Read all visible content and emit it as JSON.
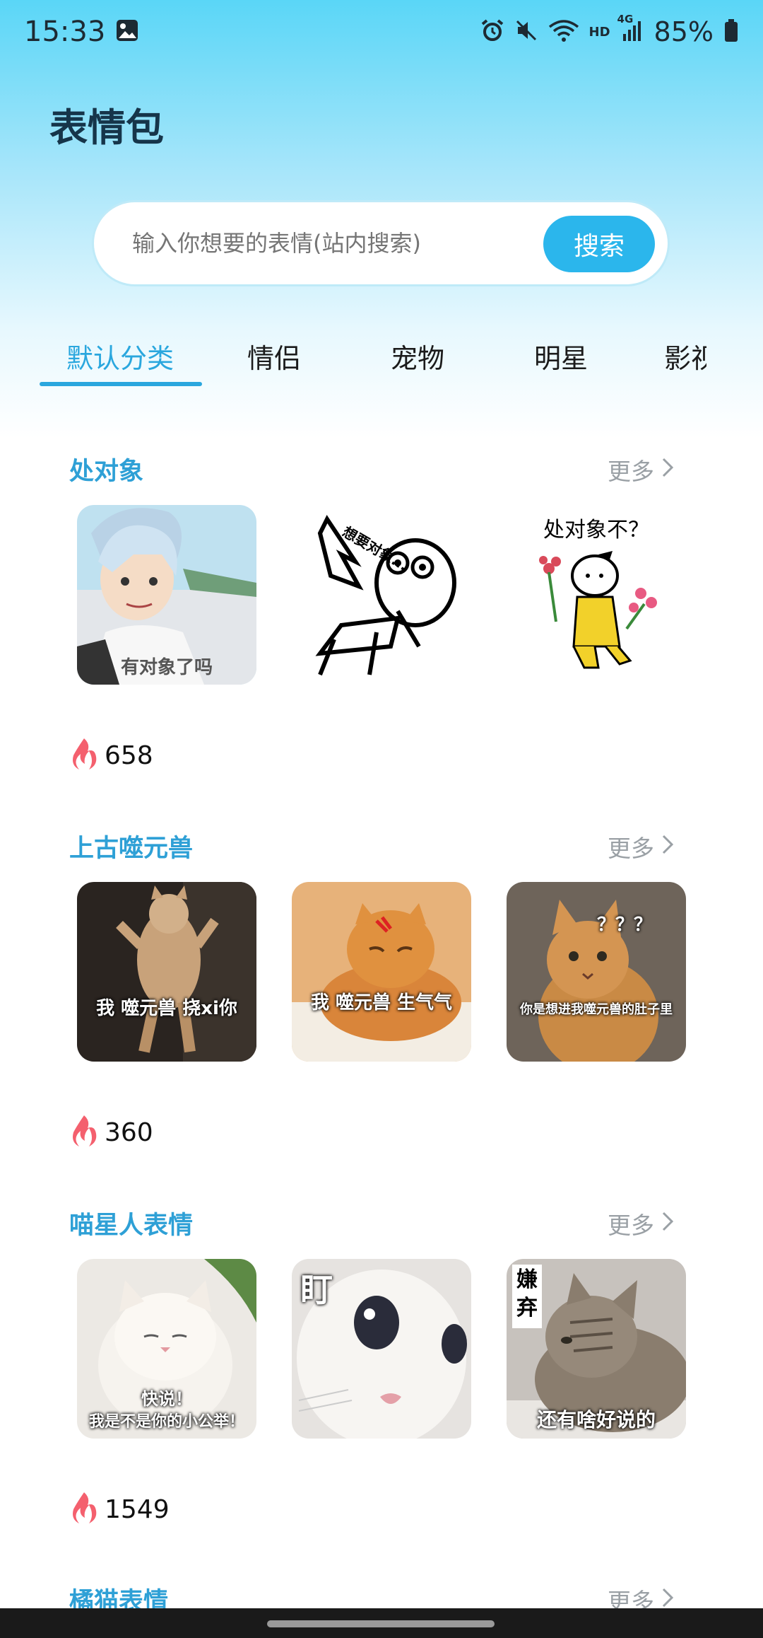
{
  "status": {
    "time": "15:33",
    "battery": "85%",
    "net": "4G",
    "hd": "HD"
  },
  "app": {
    "title": "表情包"
  },
  "search": {
    "placeholder": "输入你想要的表情(站内搜索)",
    "button": "搜索"
  },
  "tabs": [
    {
      "label": "默认分类",
      "active": true
    },
    {
      "label": "情侣"
    },
    {
      "label": "宠物"
    },
    {
      "label": "明星"
    },
    {
      "label": "影视"
    }
  ],
  "sections": [
    {
      "title": "处对象",
      "more": "更多",
      "count": "658",
      "thumbs": [
        {
          "caption": "有对象了吗"
        },
        {
          "caption": "想要对象..."
        },
        {
          "caption": "处对象不？"
        }
      ]
    },
    {
      "title": "上古噬元兽",
      "more": "更多",
      "count": "360",
      "thumbs": [
        {
          "caption": "我 噬元兽 挠xi你"
        },
        {
          "caption": "我 噬元兽 生气气"
        },
        {
          "caption": "你是想进我噬元兽的肚子里",
          "marks": "？？？"
        }
      ]
    },
    {
      "title": "喵星人表情",
      "more": "更多",
      "count": "1549",
      "thumbs": [
        {
          "caption1": "快说！",
          "caption2": "我是不是你的小公举！"
        },
        {
          "caption": "盯"
        },
        {
          "caption": "还有啥好说的",
          "label": "嫌弃"
        }
      ]
    },
    {
      "title": "橘猫表情",
      "more": "更多"
    }
  ],
  "colors": {
    "accent": "#2aa7de",
    "button": "#2bb6ec",
    "flame": "#f4606e"
  }
}
